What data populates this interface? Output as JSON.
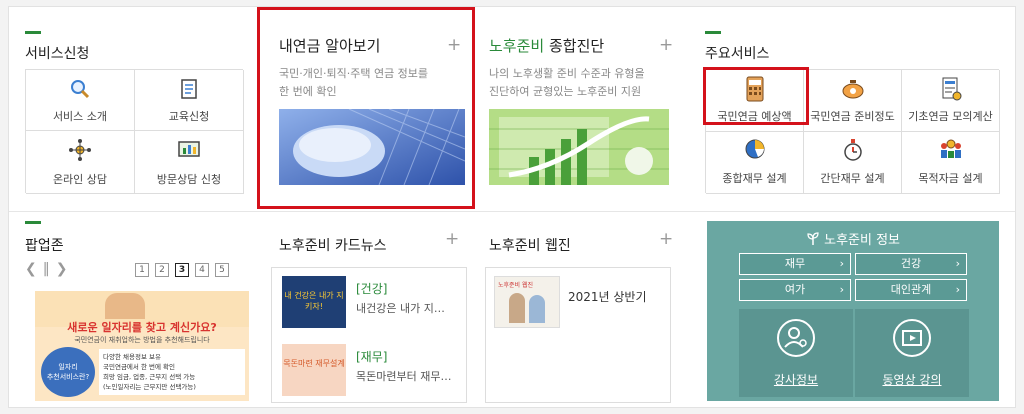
{
  "services": {
    "title": "서비스신청",
    "items": [
      {
        "label": "서비스 소개",
        "icon": "magnifier-icon"
      },
      {
        "label": "교육신청",
        "icon": "notebook-icon"
      },
      {
        "label": "온라인 상담",
        "icon": "network-icon"
      },
      {
        "label": "방문상담 신청",
        "icon": "monitor-chart-icon"
      }
    ]
  },
  "pension": {
    "title": "내연금 알아보기",
    "plus": "+",
    "desc_line1": "국민·개인·퇴직·주택 연금 정보를",
    "desc_line2": "한 번에 확인"
  },
  "diagnosis": {
    "title_green": "노후준비",
    "title_rest": " 종합진단",
    "plus": "+",
    "desc_line1": "나의 노후생활 준비 수준과 유형을",
    "desc_line2": "진단하여 균형있는 노후준비 지원"
  },
  "main_services": {
    "title": "주요서비스",
    "items": [
      {
        "label": "국민연금 예상액",
        "icon": "calculator-icon"
      },
      {
        "label": "국민연금 준비정도",
        "icon": "piggy-bank-icon"
      },
      {
        "label": "기초연금 모의계산",
        "icon": "document-icon"
      },
      {
        "label": "종합재무 설계",
        "icon": "pie-chart-icon"
      },
      {
        "label": "간단재무 설계",
        "icon": "stopwatch-icon"
      },
      {
        "label": "목적자금 설계",
        "icon": "people-money-icon"
      }
    ]
  },
  "popup": {
    "title": "팝업존",
    "pages": [
      "1",
      "2",
      "3",
      "4",
      "5"
    ],
    "active_page": "3",
    "banner": {
      "headline": "새로운 일자리를 찾고 계신가요?",
      "sub1": "국민연금이 재취업하는 방법을 추천해드립니다",
      "badge_line1": "일자리",
      "badge_line2": "추천서비스란?",
      "bullet1": "다양한 채용정보 보유",
      "bullet2": "국민연금에서 한 번에 확인",
      "bullet3": "희망 임금, 업종, 근무지 선택 가능",
      "bullet4": "(노인일자리는 근무지만 선택가능)"
    }
  },
  "cardnews": {
    "title_green": "노후준비",
    "title_rest": " 카드뉴스",
    "plus": "+",
    "items": [
      {
        "tag": "[건강]",
        "text": "내건강은 내가 지…",
        "thumb_text": "내 건강은 내가 지키자!"
      },
      {
        "tag": "[재무]",
        "text": "목돈마련부터 재무…",
        "thumb_text": "목돈마련 재무설계"
      }
    ]
  },
  "webzine": {
    "title_green": "노후준비",
    "title_rest": " 웹진",
    "plus": "+",
    "item_text": "2021년 상반기",
    "thumb_text": "노후준비 웹진"
  },
  "info": {
    "title": "노후준비 정보",
    "buttons": [
      "재무",
      "건강",
      "여가",
      "대인관계"
    ],
    "arrow": "›",
    "big1": "강사정보",
    "big2": "동영상 강의"
  },
  "colors": {
    "accent_green": "#2a8a3a",
    "highlight_red": "#d4111b",
    "info_teal": "#6aa7a2",
    "pension_blue": "#3d63b8"
  }
}
